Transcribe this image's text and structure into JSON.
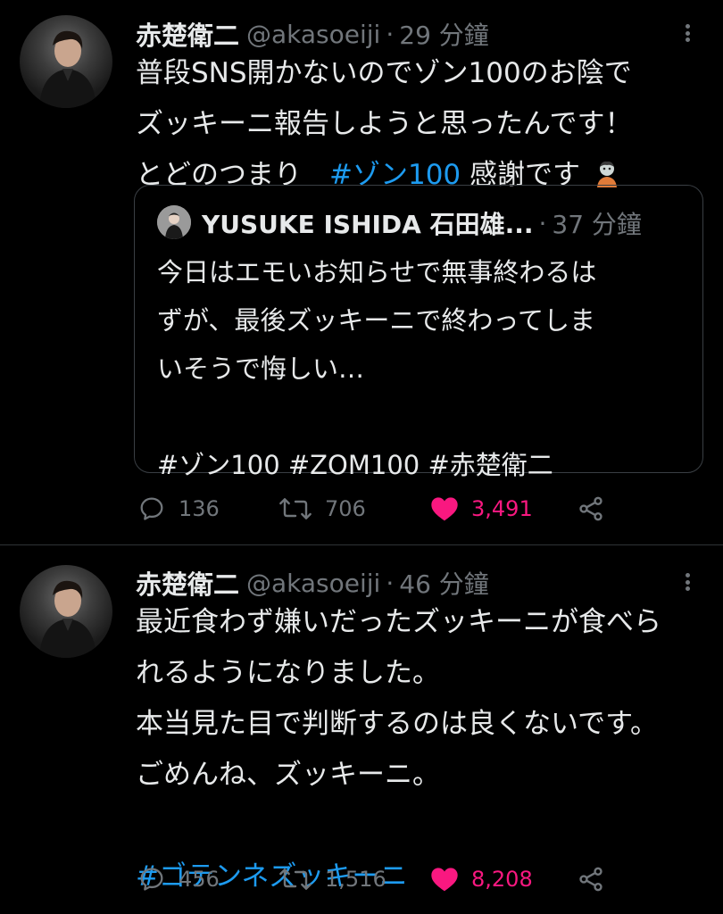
{
  "tweets": [
    {
      "name": "赤楚衛二",
      "handle": "@akasoeiji",
      "separator": "·",
      "time": "29 分鐘",
      "lines": [
        "普段SNS開かないのでゾン100のお陰で",
        "ズッキーニ報告しようと思ったんです！"
      ],
      "line3_prefix": "とどのつまり　",
      "line3_hashtag": "#ゾン100",
      "line3_suffix": " 感謝です",
      "emoji": "zombie-emoji",
      "quote": {
        "name": "YUSUKE ISHIDA 石田雄...",
        "separator": "·",
        "time": "37 分鐘",
        "lines": [
          "今日はエモいお知らせで無事終わるは",
          "ずが、最後ズッキーニで終わってしま",
          "いそうで悔しい…",
          "",
          "#ゾン100 #ZOM100 #赤楚衛二"
        ]
      },
      "replies": "136",
      "retweets": "706",
      "likes": "3,491"
    },
    {
      "name": "赤楚衛二",
      "handle": "@akasoeiji",
      "separator": "·",
      "time": "46 分鐘",
      "lines": [
        "最近食わず嫌いだったズッキーニが食べら",
        "れるようになりました。",
        "本当見た目で判断するのは良くないです。",
        "ごめんね、ズッキーニ。",
        ""
      ],
      "hashtag_line": "#ゴテンネズッキーニ",
      "replies": "456",
      "retweets": "1,516",
      "likes": "8,208"
    }
  ],
  "colors": {
    "background": "#000000",
    "text": "#e7e9ea",
    "muted": "#71767b",
    "hashtag": "#1d9bf0",
    "like": "#f91880"
  }
}
